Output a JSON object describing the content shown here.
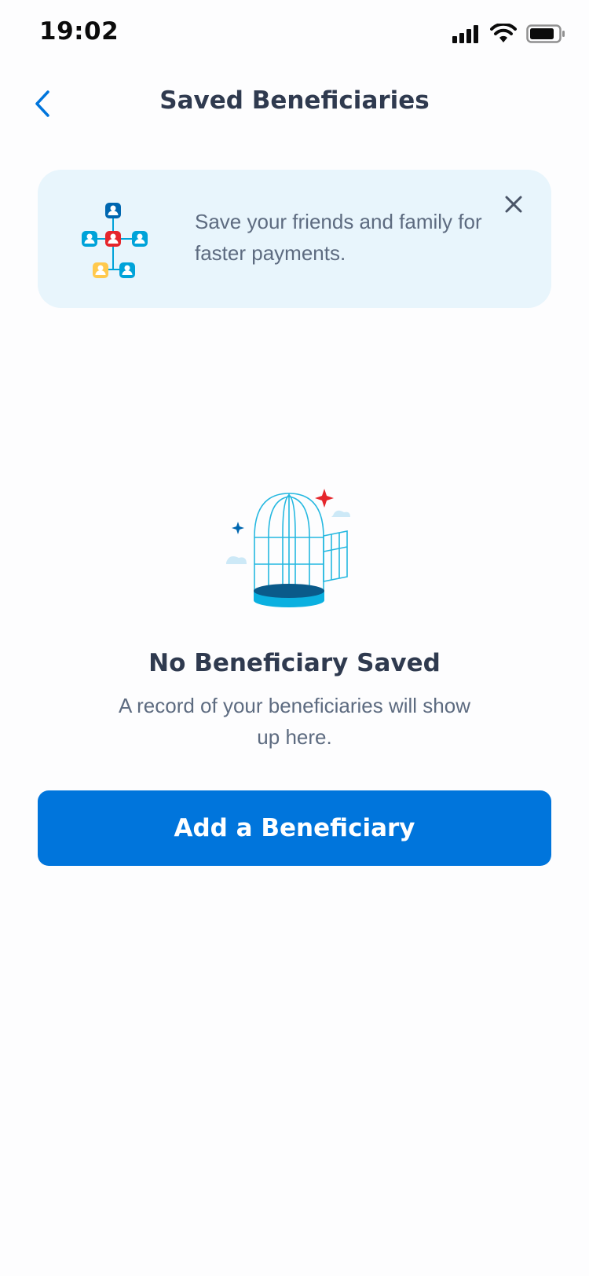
{
  "status_bar": {
    "time": "19:02",
    "icons": [
      "signal-icon",
      "wifi-icon",
      "battery-icon"
    ]
  },
  "nav": {
    "back_icon": "chevron-left-icon",
    "title": "Saved Beneficiaries"
  },
  "banner": {
    "illustration": "beneficiary-network-illustration",
    "text": "Save your friends and family for faster payments.",
    "close_icon": "close-icon"
  },
  "empty_state": {
    "illustration": "empty-birdcage-illustration",
    "title": "No Beneficiary Saved",
    "description": "A record of your beneficiaries will show up here."
  },
  "actions": {
    "add_label": "Add a Beneficiary"
  },
  "colors": {
    "primary": "#0075dc",
    "banner_bg": "#e8f5fc",
    "title": "#2f3a4f",
    "muted": "#5d6b80",
    "accent_red": "#e5262c"
  }
}
